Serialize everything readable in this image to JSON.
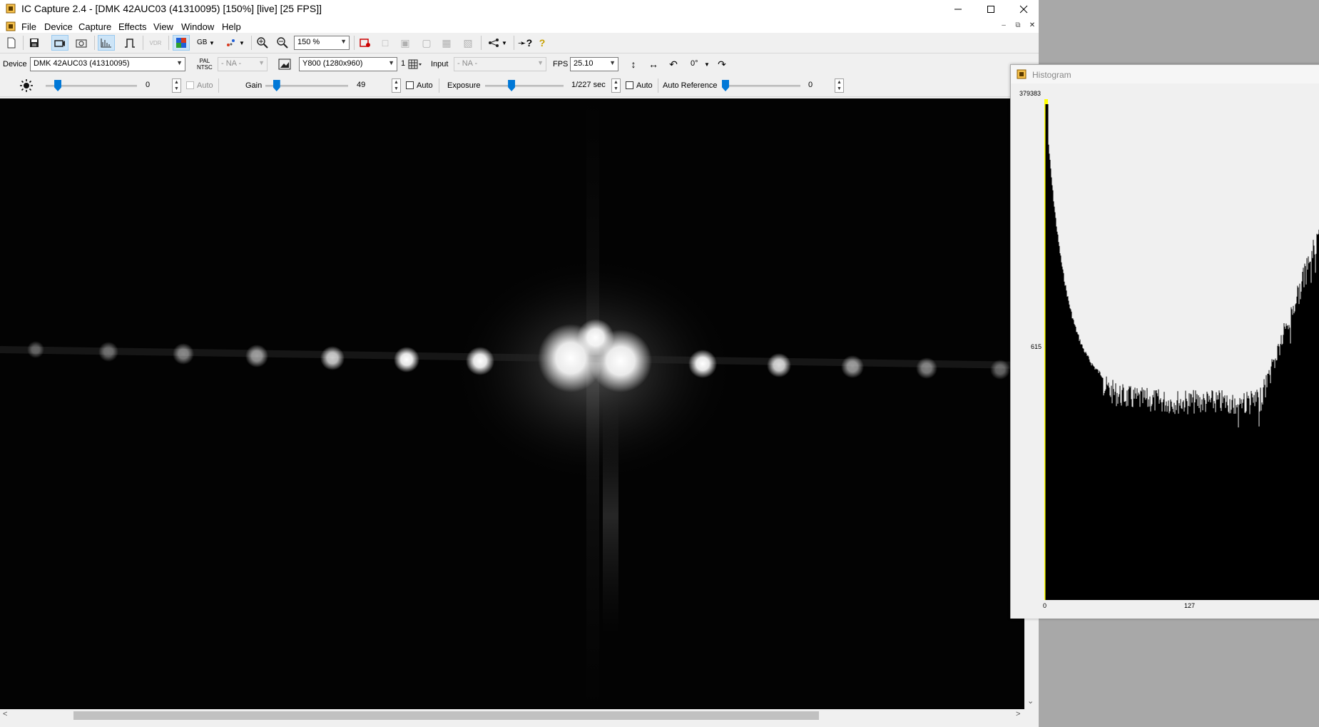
{
  "window": {
    "title": "IC Capture 2.4 - [DMK 42AUC03 (41310095) [150%]  [live]  [25 FPS]]"
  },
  "menu": [
    "File",
    "Device",
    "Capture",
    "Effects",
    "View",
    "Window",
    "Help"
  ],
  "toolbar": {
    "zoom": "150 %",
    "gb_label": "GB"
  },
  "device_bar": {
    "device_label": "Device",
    "device_value": "DMK 42AUC03 (41310095)",
    "pal_top": "PAL",
    "pal_bottom": "NTSC",
    "norm_value": "- NA -",
    "format_value": "Y800 (1280x960)",
    "binning_digit": "1",
    "input_label": "Input",
    "input_value": "- NA -",
    "fps_label": "FPS",
    "fps_value": "25.10",
    "rotation_value": "0°"
  },
  "controls": {
    "brightness": {
      "value": "0",
      "auto_label": "Auto",
      "level": 0.11
    },
    "gain": {
      "label": "Gain",
      "value": "49",
      "auto_label": "Auto",
      "level": 0.11
    },
    "exposure": {
      "label": "Exposure",
      "value": "1/227 sec",
      "auto_label": "Auto",
      "level": 0.31
    },
    "auto_reference": {
      "label": "Auto Reference",
      "value": "0",
      "level": 0.0
    }
  },
  "histogram": {
    "title": "Histogram",
    "y_max_label": "379383",
    "y_mid_label": "615",
    "x_labels": [
      "0",
      "127"
    ],
    "colors": {
      "bar": "#000000",
      "zero_line": "#ffff00"
    }
  }
}
